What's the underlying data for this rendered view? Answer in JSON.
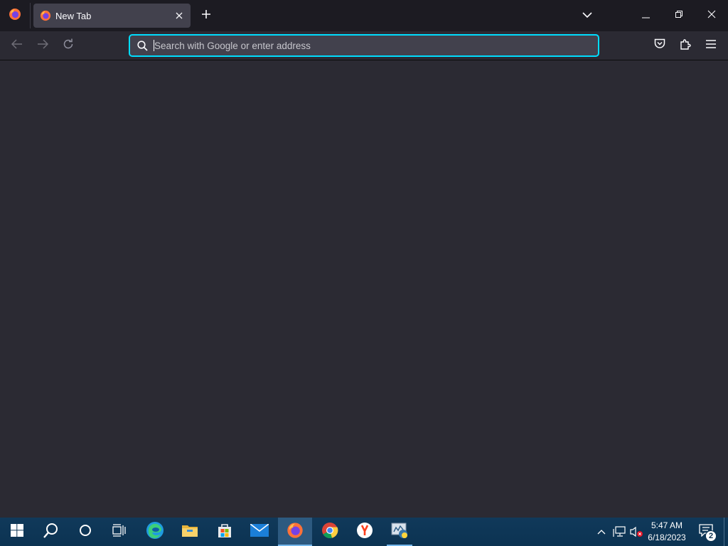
{
  "browser": {
    "tabs": [
      {
        "title": "New Tab",
        "active": true
      }
    ],
    "urlbar": {
      "placeholder": "Search with Google or enter address",
      "value": ""
    }
  },
  "taskbar": {
    "pinned": [
      {
        "name": "start",
        "icon": "windows-logo-icon"
      },
      {
        "name": "search",
        "icon": "search-icon"
      },
      {
        "name": "cortana",
        "icon": "cortana-circle-icon"
      },
      {
        "name": "task-view",
        "icon": "task-view-icon"
      },
      {
        "name": "edge",
        "icon": "edge-icon"
      },
      {
        "name": "file-explorer",
        "icon": "folder-icon"
      },
      {
        "name": "store",
        "icon": "store-icon"
      },
      {
        "name": "mail",
        "icon": "mail-icon"
      },
      {
        "name": "firefox",
        "icon": "firefox-icon",
        "active": true
      },
      {
        "name": "chrome",
        "icon": "chrome-icon"
      },
      {
        "name": "yandex",
        "icon": "yandex-icon"
      },
      {
        "name": "python-app",
        "icon": "python-app-icon",
        "running": true
      }
    ],
    "clock": {
      "time": "5:47 AM",
      "date": "6/18/2023"
    },
    "notifications": {
      "count": "2"
    }
  },
  "colors": {
    "tabstrip_bg": "#1c1b22",
    "toolbar_bg": "#2b2a33",
    "active_tab_bg": "#42414d",
    "focus_ring": "#00ddff",
    "taskbar_bg": "#0c3352",
    "taskbar_active": "#2d5a80"
  }
}
